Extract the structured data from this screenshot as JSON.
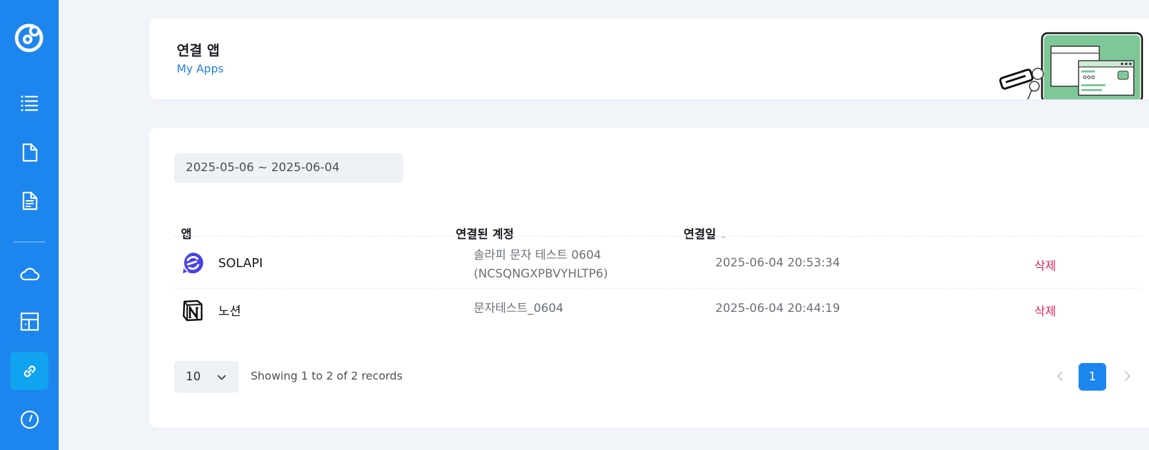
{
  "sidebar": {
    "items": [
      {
        "icon": "list-icon"
      },
      {
        "icon": "document-icon"
      },
      {
        "icon": "document-text-icon"
      },
      {
        "icon": "cloud-icon"
      },
      {
        "icon": "layout-icon"
      },
      {
        "icon": "link-icon",
        "active": true
      },
      {
        "icon": "dashboard-icon"
      }
    ]
  },
  "header": {
    "title": "연결 앱",
    "subtitle": "My Apps"
  },
  "filter": {
    "date_range": "2025-05-06 ~ 2025-06-04"
  },
  "table": {
    "columns": [
      "앱",
      "연결된 계정",
      "연결일"
    ],
    "rows": [
      {
        "app_icon": "solapi-icon",
        "app": "SOLAPI",
        "account_line1": "솔라피 문자 테스트 0604",
        "account_line2": "(NCSQNGXPBVYHLTP6)",
        "date": "2025-06-04 20:53:34",
        "action": "삭제"
      },
      {
        "app_icon": "notion-icon",
        "app": "노션",
        "account_line1": "문자테스트_0604",
        "account_line2": "",
        "date": "2025-06-04 20:44:19",
        "action": "삭제"
      }
    ]
  },
  "footer": {
    "page_size": "10",
    "records_text": "Showing 1 to 2 of 2 records",
    "current_page": "1"
  },
  "colors": {
    "sidebar": "#1d86ee",
    "sidebar_active": "#0fa3f0",
    "accent": "#1d86ee",
    "delete": "#e0245e"
  }
}
